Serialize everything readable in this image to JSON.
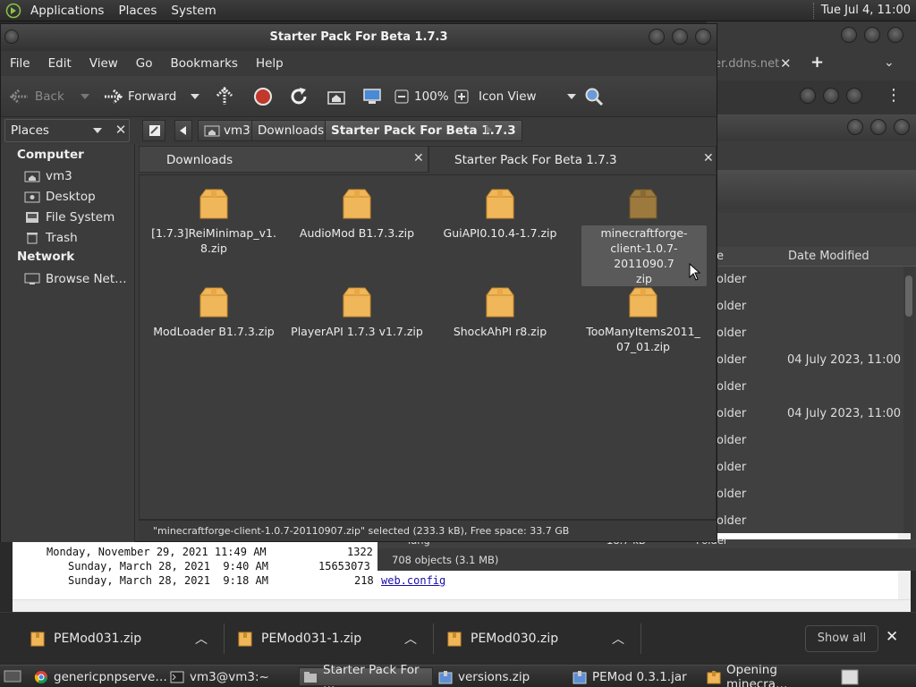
{
  "top_panel": {
    "menus": [
      "Applications",
      "Places",
      "System"
    ],
    "clock": "Tue Jul 4, 11:00"
  },
  "bg_browser": {
    "tab_partial_text": "er.ddns.net"
  },
  "bg_file_manager": {
    "columns": {
      "type": "e",
      "date": "Date Modified"
    },
    "rows": [
      {
        "type": "older",
        "date": ""
      },
      {
        "type": "older",
        "date": ""
      },
      {
        "type": "older",
        "date": ""
      },
      {
        "type": "older",
        "date": "04 July 2023, 11:00"
      },
      {
        "type": "older",
        "date": ""
      },
      {
        "type": "older",
        "date": "04 July 2023, 11:00"
      },
      {
        "type": "older",
        "date": ""
      },
      {
        "type": "older",
        "date": ""
      },
      {
        "type": "older",
        "date": ""
      },
      {
        "type": "older",
        "date": ""
      }
    ],
    "partial_row": {
      "name": "lang",
      "size": "18.7 kB",
      "type": "Folder"
    },
    "status": "708 objects (3.1 MB)"
  },
  "bg_webpage": {
    "lines": [
      {
        "date": "Monday, November 29, 2021 11:49 AM",
        "size": "1322"
      },
      {
        "date": "Sunday, March 28, 2021  9:40 AM",
        "size": "15653073"
      },
      {
        "date": "Sunday, March 28, 2021  9:18 AM",
        "size": "218",
        "link": "web.config"
      }
    ]
  },
  "window": {
    "title": "Starter Pack For Beta 1.7.3",
    "menu": [
      "File",
      "Edit",
      "View",
      "Go",
      "Bookmarks",
      "Help"
    ],
    "toolbar": {
      "back": "Back",
      "forward": "Forward",
      "zoom": "100%",
      "view_mode": "Icon View"
    },
    "location": {
      "places_label": "Places",
      "crumbs": [
        "vm3",
        "Downloads",
        "Starter Pack For Beta 1.7.3"
      ]
    },
    "sidebar": {
      "computer_heading": "Computer",
      "computer_items": [
        "vm3",
        "Desktop",
        "File System",
        "Trash"
      ],
      "network_heading": "Network",
      "network_items": [
        "Browse Net…"
      ]
    },
    "tabs": [
      "Downloads",
      "Starter Pack For Beta 1.7.3"
    ],
    "files": [
      {
        "name": "[1.7.3]ReiMinimap_v1.\n8.zip"
      },
      {
        "name": "AudioMod B1.7.3.zip"
      },
      {
        "name": "GuiAPI0.10.4-1.7.zip"
      },
      {
        "name": "minecraftforge-\nclient-1.0.7-2011090.7\nzip",
        "selected": true
      },
      {
        "name": "ModLoader B1.7.3.zip"
      },
      {
        "name": "PlayerAPI 1.7.3 v1.7.zip"
      },
      {
        "name": "ShockAhPI r8.zip"
      },
      {
        "name": "TooManyItems2011_\n07_01.zip"
      }
    ],
    "status": "\"minecraftforge-client-1.0.7-20110907.zip\" selected (233.3 kB), Free space: 33.7 GB"
  },
  "downloads": {
    "items": [
      "PEMod031.zip",
      "PEMod031-1.zip",
      "PEMod030.zip"
    ],
    "show_all": "Show all"
  },
  "taskbar": {
    "items": [
      "genericpnpserve…",
      "vm3@vm3:~",
      "Starter Pack For …",
      "versions.zip",
      "PEMod 0.3.1.jar",
      "Opening minecra…"
    ]
  },
  "colors": {
    "folder_zip": "#f0b75a",
    "accent_stop": "#c0392b"
  }
}
